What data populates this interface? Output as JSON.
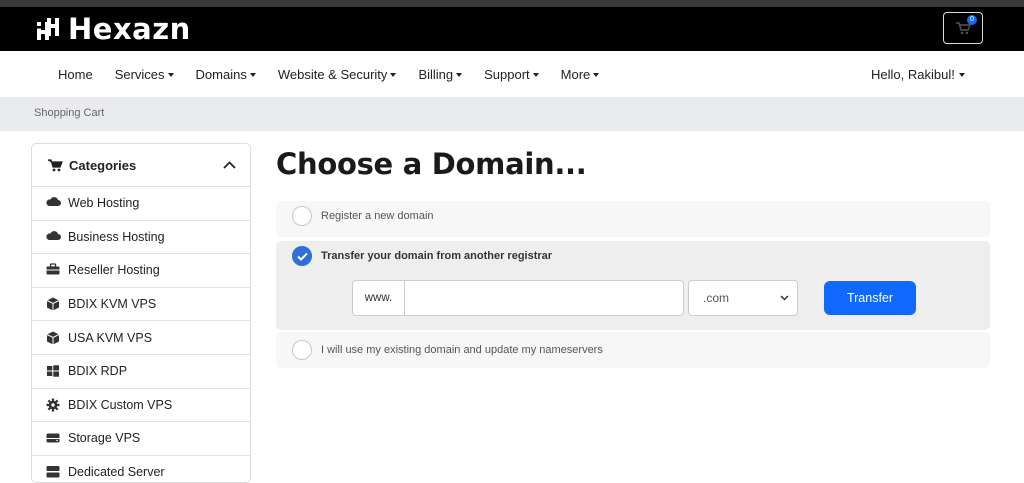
{
  "brand": {
    "name": "Hexazn"
  },
  "cart": {
    "count": "0"
  },
  "nav": {
    "items": [
      {
        "label": "Home",
        "dropdown": false
      },
      {
        "label": "Services",
        "dropdown": true
      },
      {
        "label": "Domains",
        "dropdown": true
      },
      {
        "label": "Website & Security",
        "dropdown": true
      },
      {
        "label": "Billing",
        "dropdown": true
      },
      {
        "label": "Support",
        "dropdown": true
      },
      {
        "label": "More",
        "dropdown": true
      }
    ],
    "user": "Hello, Rakibul!"
  },
  "breadcrumb": "Shopping Cart",
  "sidebar": {
    "title": "Categories",
    "items": [
      {
        "label": "Web Hosting",
        "icon": "cloud-icon"
      },
      {
        "label": "Business Hosting",
        "icon": "cloud-icon"
      },
      {
        "label": "Reseller Hosting",
        "icon": "briefcase-icon"
      },
      {
        "label": "BDIX KVM VPS",
        "icon": "cube-icon"
      },
      {
        "label": "USA KVM VPS",
        "icon": "cube-icon"
      },
      {
        "label": "BDIX RDP",
        "icon": "windows-icon"
      },
      {
        "label": "BDIX Custom VPS",
        "icon": "cog-icon"
      },
      {
        "label": "Storage VPS",
        "icon": "hdd-icon"
      },
      {
        "label": "Dedicated Server",
        "icon": "server-icon"
      }
    ]
  },
  "main": {
    "title": "Choose a Domain...",
    "options": {
      "register": "Register a new domain",
      "transfer": "Transfer your domain from another registrar",
      "existing": "I will use my existing domain and update my nameservers"
    },
    "transfer_form": {
      "prefix": "www.",
      "input_value": "",
      "input_placeholder": "",
      "tld_selected": ".com",
      "button": "Transfer"
    }
  },
  "colors": {
    "accent": "#1168ff",
    "radio_checked": "#2f6fd6",
    "header": "#000000"
  }
}
